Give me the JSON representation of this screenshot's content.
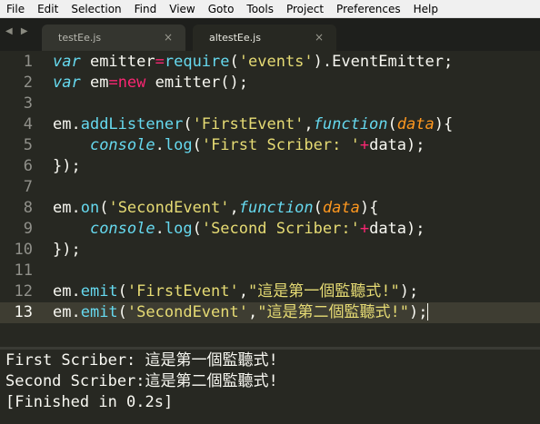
{
  "menu": [
    "File",
    "Edit",
    "Selection",
    "Find",
    "View",
    "Goto",
    "Tools",
    "Project",
    "Preferences",
    "Help"
  ],
  "tabs": [
    {
      "label": "testEe.js",
      "close": "×",
      "active": false
    },
    {
      "label": "altestEe.js",
      "close": "×",
      "active": true
    }
  ],
  "nav_arrows": "◀ ▶",
  "editor": {
    "current_line": 13,
    "line_numbers": [
      "1",
      "2",
      "3",
      "4",
      "5",
      "6",
      "7",
      "8",
      "9",
      "10",
      "11",
      "12",
      "13"
    ],
    "lines": [
      [
        {
          "t": "var",
          "c": "kw"
        },
        {
          "t": " emitter"
        },
        {
          "t": "=",
          "c": "op"
        },
        {
          "t": "require",
          "c": "fn"
        },
        {
          "t": "("
        },
        {
          "t": "'events'",
          "c": "str"
        },
        {
          "t": ").EventEmitter;"
        }
      ],
      [
        {
          "t": "var",
          "c": "kw"
        },
        {
          "t": " em"
        },
        {
          "t": "=",
          "c": "op"
        },
        {
          "t": "new",
          "c": "op"
        },
        {
          "t": " emitter();"
        }
      ],
      [],
      [
        {
          "t": "em."
        },
        {
          "t": "addListener",
          "c": "fn"
        },
        {
          "t": "("
        },
        {
          "t": "'FirstEvent'",
          "c": "str"
        },
        {
          "t": ","
        },
        {
          "t": "function",
          "c": "kw"
        },
        {
          "t": "("
        },
        {
          "t": "data",
          "c": "arg"
        },
        {
          "t": "){"
        }
      ],
      [
        {
          "t": "    "
        },
        {
          "t": "console",
          "c": "kw"
        },
        {
          "t": "."
        },
        {
          "t": "log",
          "c": "fn"
        },
        {
          "t": "("
        },
        {
          "t": "'First Scriber: '",
          "c": "str"
        },
        {
          "t": "+",
          "c": "op"
        },
        {
          "t": "data);"
        }
      ],
      [
        {
          "t": "});"
        }
      ],
      [],
      [
        {
          "t": "em."
        },
        {
          "t": "on",
          "c": "fn"
        },
        {
          "t": "("
        },
        {
          "t": "'SecondEvent'",
          "c": "str"
        },
        {
          "t": ","
        },
        {
          "t": "function",
          "c": "kw"
        },
        {
          "t": "("
        },
        {
          "t": "data",
          "c": "arg"
        },
        {
          "t": "){"
        }
      ],
      [
        {
          "t": "    "
        },
        {
          "t": "console",
          "c": "kw"
        },
        {
          "t": "."
        },
        {
          "t": "log",
          "c": "fn"
        },
        {
          "t": "("
        },
        {
          "t": "'Second Scriber:'",
          "c": "str"
        },
        {
          "t": "+",
          "c": "op"
        },
        {
          "t": "data);"
        }
      ],
      [
        {
          "t": "});"
        }
      ],
      [],
      [
        {
          "t": "em."
        },
        {
          "t": "emit",
          "c": "fn"
        },
        {
          "t": "("
        },
        {
          "t": "'FirstEvent'",
          "c": "str"
        },
        {
          "t": ","
        },
        {
          "t": "\"這是第一個監聽式!\"",
          "c": "str"
        },
        {
          "t": ");"
        }
      ],
      [
        {
          "t": "em."
        },
        {
          "t": "emit",
          "c": "fn"
        },
        {
          "t": "("
        },
        {
          "t": "'SecondEvent'",
          "c": "str"
        },
        {
          "t": ","
        },
        {
          "t": "\"這是第二個監聽式!\"",
          "c": "str"
        },
        {
          "t": ");"
        }
      ]
    ]
  },
  "output": {
    "lines": [
      "First Scriber: 這是第一個監聽式!",
      "Second Scriber:這是第二個監聽式!",
      "[Finished in 0.2s]"
    ]
  },
  "colors": {
    "background": "#272822",
    "keyword": "#66d9ef",
    "string": "#e6db74",
    "operator": "#f92672",
    "argument": "#fd971f"
  }
}
